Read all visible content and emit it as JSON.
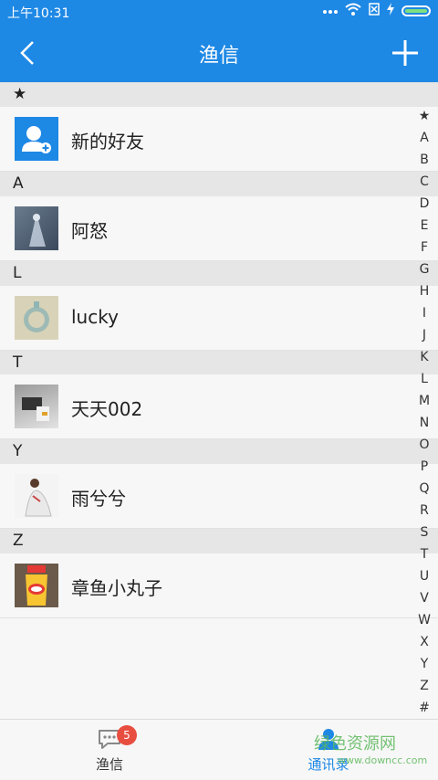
{
  "status_bar": {
    "time": "上午10:31"
  },
  "app_bar": {
    "title": "渔信"
  },
  "sections": [
    {
      "header": "★",
      "contacts": [
        {
          "name": "新的好友",
          "avatar": "new-friend-icon"
        }
      ]
    },
    {
      "header": "A",
      "contacts": [
        {
          "name": "阿怒",
          "avatar": "photo"
        }
      ]
    },
    {
      "header": "L",
      "contacts": [
        {
          "name": "lucky",
          "avatar": "photo"
        }
      ]
    },
    {
      "header": "T",
      "contacts": [
        {
          "name": "天天002",
          "avatar": "photo"
        }
      ]
    },
    {
      "header": "Y",
      "contacts": [
        {
          "name": "雨兮兮",
          "avatar": "photo"
        }
      ]
    },
    {
      "header": "Z",
      "contacts": [
        {
          "name": "章鱼小丸子",
          "avatar": "photo"
        }
      ]
    }
  ],
  "index_letters": [
    "★",
    "A",
    "B",
    "C",
    "D",
    "E",
    "F",
    "G",
    "H",
    "I",
    "J",
    "K",
    "L",
    "M",
    "N",
    "O",
    "P",
    "Q",
    "R",
    "S",
    "T",
    "U",
    "V",
    "W",
    "X",
    "Y",
    "Z",
    "#"
  ],
  "tabs": [
    {
      "label": "渔信",
      "badge": "5",
      "icon": "chat-icon"
    },
    {
      "label": "通讯录",
      "icon": "contacts-icon",
      "active": true
    }
  ],
  "watermark": {
    "text": "绿色资源网",
    "sub": "www.downcc.com"
  },
  "colors": {
    "primary": "#1e88e5",
    "badge": "#e84e40",
    "section_bg": "#e6e6e6"
  }
}
